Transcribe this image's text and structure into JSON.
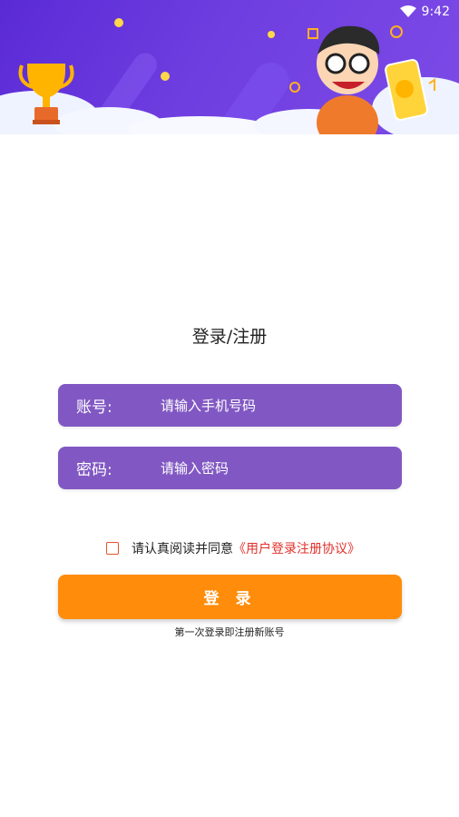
{
  "status_bar": {
    "time": "9:42"
  },
  "page": {
    "title": "登录/注册"
  },
  "form": {
    "account_label": "账号:",
    "account_placeholder": "请输入手机号码",
    "password_label": "密码:",
    "password_placeholder": "请输入密码"
  },
  "agreement": {
    "text": "请认真阅读并同意",
    "link": "《用户登录注册协议》"
  },
  "login_button": "登 录",
  "hint": "第一次登录即注册新账号",
  "colors": {
    "banner": "#6a38de",
    "field": "#8158c3",
    "button": "#ff8c0a",
    "link": "#e0302a"
  }
}
